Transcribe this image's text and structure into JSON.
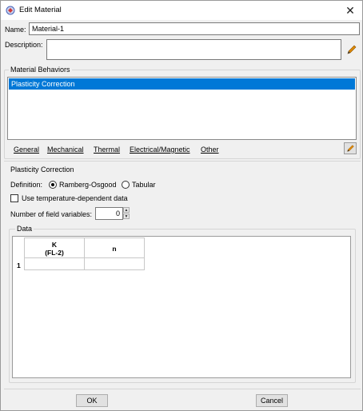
{
  "window": {
    "title": "Edit Material",
    "close_glyph": "✕"
  },
  "form": {
    "name_label": "Name:",
    "name_value": "Material-1",
    "description_label": "Description:",
    "description_value": ""
  },
  "behaviors": {
    "group_title": "Material Behaviors",
    "items": [
      "Plasticity Correction"
    ],
    "selected": "Plasticity Correction"
  },
  "menu": {
    "items": [
      "General",
      "Mechanical",
      "Thermal",
      "Electrical/Magnetic",
      "Other"
    ]
  },
  "plasticity": {
    "group_title": "Plasticity Correction",
    "definition_label": "Definition:",
    "options": [
      "Ramberg-Osgood",
      "Tabular"
    ],
    "selected_option": "Ramberg-Osgood",
    "temp_dependent_label": "Use temperature-dependent data",
    "temp_dependent_checked": false,
    "field_vars_label": "Number of field variables:",
    "field_vars_value": "0"
  },
  "data_table": {
    "group_title": "Data",
    "columns": [
      {
        "line1": "K",
        "line2": "(FL-2)"
      },
      {
        "line1": "n",
        "line2": ""
      }
    ],
    "rows": [
      {
        "index": "1",
        "cells": [
          "",
          ""
        ]
      }
    ]
  },
  "buttons": {
    "ok": "OK",
    "cancel": "Cancel"
  },
  "colors": {
    "selection": "#0078d7",
    "edit_icon": "#e08a00"
  }
}
